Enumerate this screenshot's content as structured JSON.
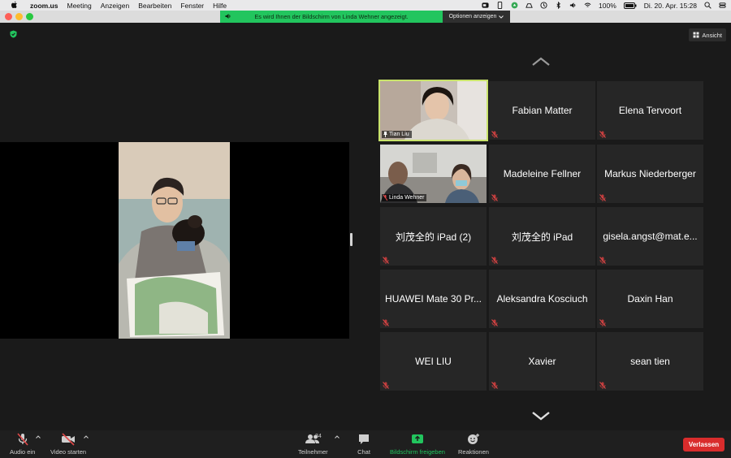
{
  "menubar": {
    "app": "zoom.us",
    "menus": [
      "Meeting",
      "Anzeigen",
      "Bearbeiten",
      "Fenster",
      "Hilfe"
    ],
    "battery": "100%",
    "clock": "Di. 20. Apr.  15:28"
  },
  "banner": {
    "text": "Es wird Ihnen der Bildschirm von Linda Wehner angezeigt.",
    "options": "Optionen anzeigen"
  },
  "view_button": "Ansicht",
  "gallery": {
    "tiles": [
      {
        "name": "Tian Liu",
        "video": true
      },
      {
        "name": "Fabian Matter",
        "video": false
      },
      {
        "name": "Elena Tervoort",
        "video": false
      },
      {
        "name": "Linda Wehner",
        "video": true
      },
      {
        "name": "Madeleine Fellner",
        "video": false
      },
      {
        "name": "Markus Niederberger",
        "video": false
      },
      {
        "name": "刘茂全的 iPad (2)",
        "video": false
      },
      {
        "name": "刘茂全的 iPad",
        "video": false
      },
      {
        "name": "gisela.angst@mat.e...",
        "video": false
      },
      {
        "name": "HUAWEI Mate 30 Pr...",
        "video": false
      },
      {
        "name": "Aleksandra Kosciuch",
        "video": false
      },
      {
        "name": "Daxin Han",
        "video": false
      },
      {
        "name": "WEI LIU",
        "video": false
      },
      {
        "name": "Xavier",
        "video": false
      },
      {
        "name": "sean tien",
        "video": false
      }
    ]
  },
  "toolbar": {
    "audio": "Audio ein",
    "video": "Video starten",
    "participants": "Teilnehmer",
    "participant_count": "34",
    "chat": "Chat",
    "share": "Bildschirm freigeben",
    "reactions": "Reaktionen",
    "leave": "Verlassen"
  },
  "colors": {
    "share_green": "#22c55e",
    "leave_red": "#d92c2c",
    "speaker_highlight": "#c9e36b"
  }
}
